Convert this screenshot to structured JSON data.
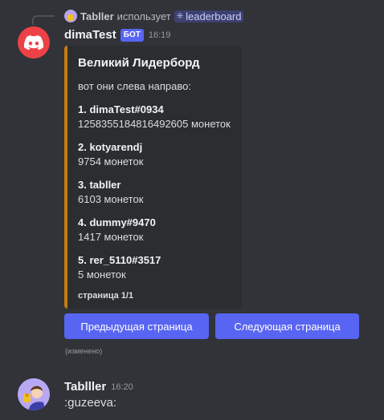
{
  "reply": {
    "username": "Tabller",
    "action": "использует",
    "command": "leaderboard"
  },
  "bot_message": {
    "username": "dimaTest",
    "tag": "БОТ",
    "time": "16:19",
    "edited": "(изменено)",
    "embed": {
      "accent_color": "#c27c0e",
      "title": "Великий Лидерборд",
      "description": "вот они слева направо:",
      "entries": [
        {
          "name": "1. dimaTest#0934",
          "value": "1258355184816492605 монеток"
        },
        {
          "name": "2. kotyarendj",
          "value": "9754 монеток"
        },
        {
          "name": "3. tabller",
          "value": "6103 монеток"
        },
        {
          "name": "4. dummy#9470",
          "value": "1417 монеток"
        },
        {
          "name": "5. rer_5110#3517",
          "value": "5 монеток"
        }
      ],
      "footer": "страница 1/1"
    },
    "buttons": {
      "prev_label": "Предыдущая страница",
      "next_label": "Следующая страница"
    }
  },
  "user_message": {
    "username": "Tablller",
    "time": "16:20",
    "text": ":guzeeva:"
  },
  "colors": {
    "background": "#313338",
    "blurple": "#5865f2",
    "discord_red": "#ed4245"
  }
}
